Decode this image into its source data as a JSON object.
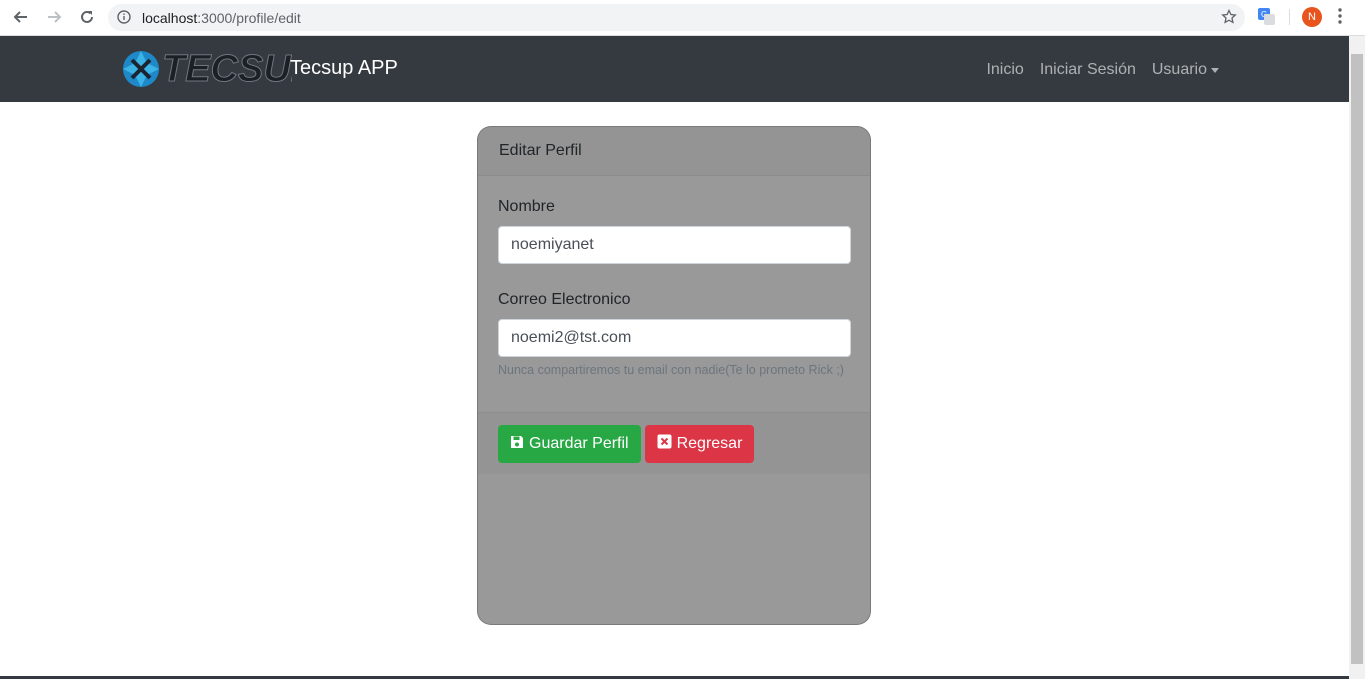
{
  "browser": {
    "url_host": "localhost",
    "url_path": ":3000/profile/edit",
    "profile_initial": "N"
  },
  "navbar": {
    "brand": "Tecsup APP",
    "logo_text": "TECSUP",
    "links": {
      "inicio": "Inicio",
      "login": "Iniciar Sesión",
      "usuario": "Usuario"
    }
  },
  "card": {
    "header": "Editar Perfil",
    "name_label": "Nombre",
    "name_value": "noemiyanet",
    "email_label": "Correo Electronico",
    "email_value": "noemi2@tst.com",
    "email_help": "Nunca compartiremos tu email con nadie(Te lo prometo Rick ;)",
    "save_label": "Guardar Perfil",
    "back_label": "Regresar"
  },
  "colors": {
    "navbar_bg": "#343a40",
    "card_bg": "#999999",
    "success": "#28a745",
    "danger": "#dc3545"
  },
  "icons": {
    "save": "floppy-disk-icon",
    "back": "close-square-icon"
  }
}
